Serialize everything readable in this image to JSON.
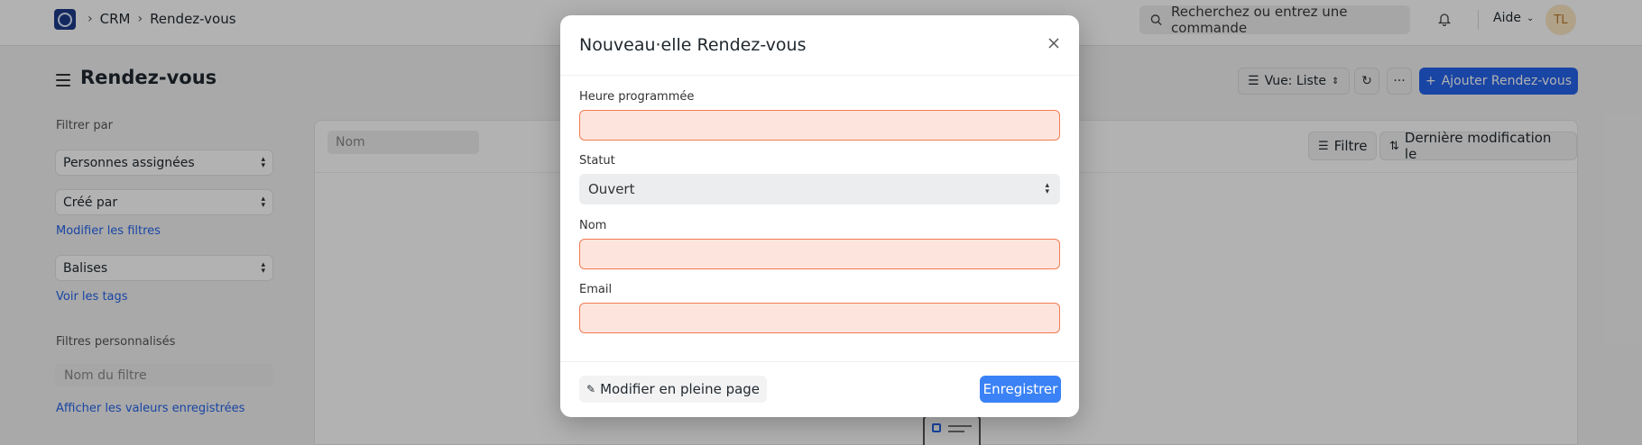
{
  "navbar": {
    "breadcrumbs": [
      "CRM",
      "Rendez-vous"
    ],
    "search_placeholder": "Recherchez ou entrez une commande",
    "help_label": "Aide",
    "avatar_initials": "TL"
  },
  "header": {
    "title": "Rendez-vous",
    "view_label": "Vue: Liste",
    "add_button": "Ajouter Rendez-vous",
    "more_label": "···"
  },
  "sidebar": {
    "filter_by_label": "Filtrer par",
    "assigned_select": "Personnes assignées",
    "created_by_select": "Créé par",
    "edit_filters_link": "Modifier les filtres",
    "tags_select": "Balises",
    "show_tags_link": "Voir les tags",
    "custom_filters_label": "Filtres personnalisés",
    "filter_name_placeholder": "Nom du filtre",
    "saved_values_link": "Afficher les valeurs enregistrées"
  },
  "list": {
    "name_filter_placeholder": "Nom",
    "filter_button": "Filtre",
    "sort_button": "Dernière modification le"
  },
  "modal": {
    "title": "Nouveau·elle Rendez-vous",
    "fields": [
      {
        "label": "Heure programmée",
        "value": ""
      },
      {
        "label": "Statut",
        "value": "Ouvert"
      },
      {
        "label": "Nom",
        "value": ""
      },
      {
        "label": "Email",
        "value": ""
      }
    ],
    "edit_full_page": "Modifier en pleine page",
    "save_button": "Enregistrer"
  },
  "colors": {
    "primary": "#3b82f6",
    "required_field_bg": "#fde5dd",
    "required_field_border": "#f27b52"
  }
}
